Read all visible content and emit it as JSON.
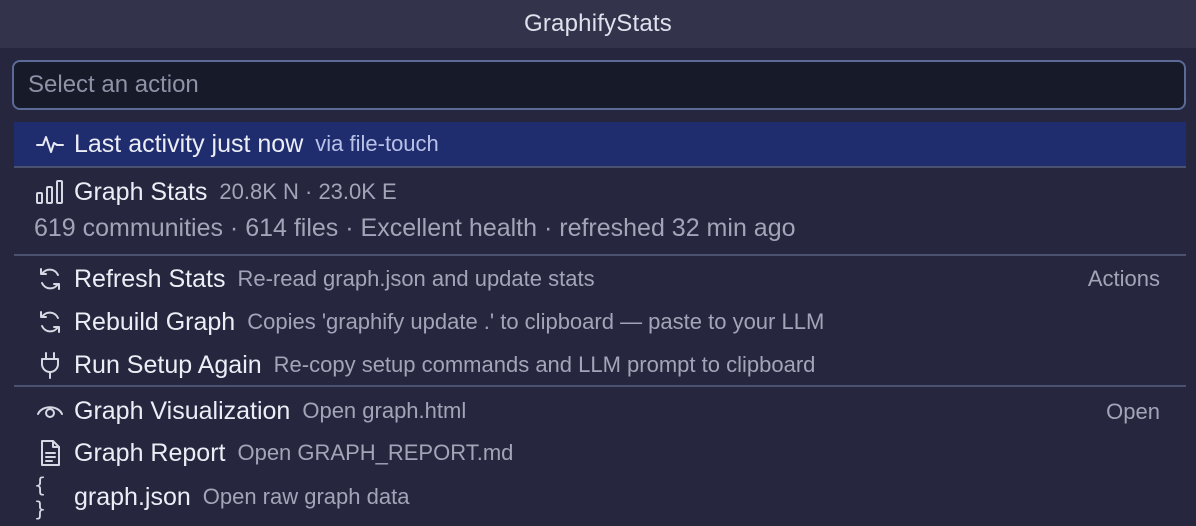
{
  "window": {
    "title": "GraphifyStats"
  },
  "search": {
    "placeholder": "Select an action",
    "value": ""
  },
  "activity": {
    "label": "Last activity just now",
    "detail": "via file-touch",
    "icon": "pulse-icon"
  },
  "stats": {
    "label": "Graph Stats",
    "detail": "20.8K N · 23.0K E",
    "summary": "619 communities · 614 files · Excellent health · refreshed 32 min ago",
    "icon": "bar-chart-icon"
  },
  "actions_section": {
    "title": "Actions",
    "items": [
      {
        "label": "Refresh Stats",
        "detail": "Re-read graph.json and update stats",
        "icon": "refresh-icon"
      },
      {
        "label": "Rebuild Graph",
        "detail": "Copies 'graphify update .' to clipboard — paste to your LLM",
        "icon": "refresh-icon"
      },
      {
        "label": "Run Setup Again",
        "detail": "Re-copy setup commands and LLM prompt to clipboard",
        "icon": "plug-icon"
      }
    ]
  },
  "open_section": {
    "title": "Open",
    "items": [
      {
        "label": "Graph Visualization",
        "detail": "Open graph.html",
        "icon": "eye-icon"
      },
      {
        "label": "Graph Report",
        "detail": "Open GRAPH_REPORT.md",
        "icon": "file-icon"
      },
      {
        "label": "graph.json",
        "detail": "Open raw graph data",
        "icon": "braces-icon"
      }
    ]
  },
  "colors": {
    "background": "#26263e",
    "titlebar": "#33344c",
    "selected": "#1f2d6f",
    "search_border": "#5b6a96"
  }
}
